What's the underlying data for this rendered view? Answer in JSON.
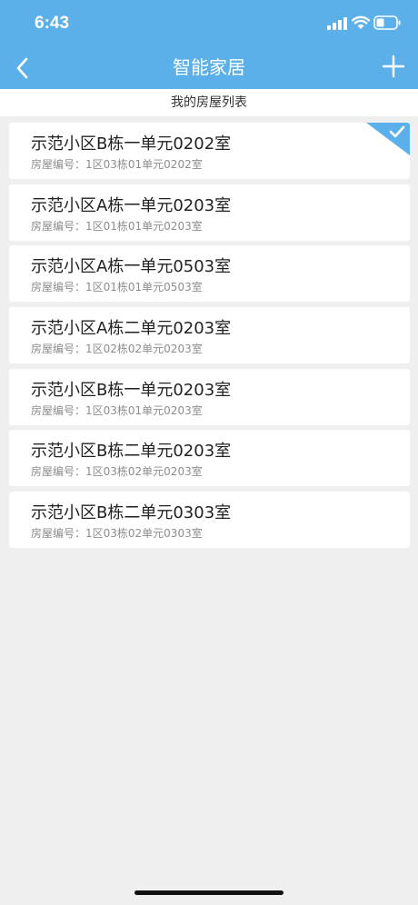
{
  "status": {
    "time": "6:43"
  },
  "nav": {
    "title": "智能家居"
  },
  "subheader": {
    "title": "我的房屋列表"
  },
  "houses": [
    {
      "name": "示范小区B栋一单元0202室",
      "code": "房屋编号：1区03栋01单元0202室",
      "selected": true
    },
    {
      "name": "示范小区A栋一单元0203室",
      "code": "房屋编号：1区01栋01单元0203室",
      "selected": false
    },
    {
      "name": "示范小区A栋一单元0503室",
      "code": "房屋编号：1区01栋01单元0503室",
      "selected": false
    },
    {
      "name": "示范小区A栋二单元0203室",
      "code": "房屋编号：1区02栋02单元0203室",
      "selected": false
    },
    {
      "name": "示范小区B栋一单元0203室",
      "code": "房屋编号：1区03栋01单元0203室",
      "selected": false
    },
    {
      "name": "示范小区B栋二单元0203室",
      "code": "房屋编号：1区03栋02单元0203室",
      "selected": false
    },
    {
      "name": "示范小区B栋二单元0303室",
      "code": "房屋编号：1区03栋02单元0303室",
      "selected": false
    }
  ],
  "colors": {
    "accent": "#5bb0ea",
    "background": "#efefef"
  },
  "icons": {
    "back": "chevron-left-icon",
    "add": "plus-icon",
    "selected": "checkmark-icon"
  }
}
